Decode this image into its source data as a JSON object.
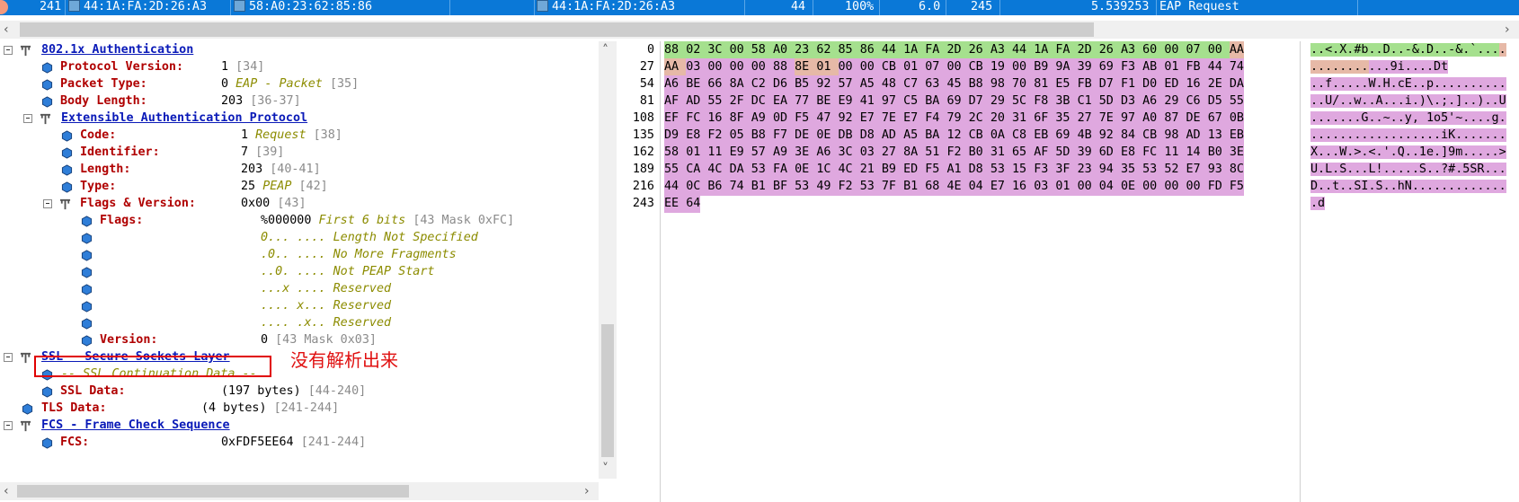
{
  "packet_row": {
    "no": "241",
    "src_mac": "44:1A:FA:2D:26:A3",
    "dst_mac": "58:A0:23:62:85:86",
    "transmitter": "44:1A:FA:2D:26:A3",
    "channel": "44",
    "signal": "100%",
    "rate": "6.0",
    "size": "245",
    "time": "5.539253",
    "info": "EAP Request"
  },
  "tree": {
    "dot1x": {
      "label": "802.1x Authentication"
    },
    "protocol_version": {
      "label": "Protocol Version:",
      "value": "1",
      "range": "[34]"
    },
    "packet_type": {
      "label": "Packet Type:",
      "value": "0",
      "enum": "EAP - Packet",
      "range": "[35]"
    },
    "body_length": {
      "label": "Body Length:",
      "value": "203",
      "range": "[36-37]"
    },
    "eap": {
      "label": "Extensible Authentication Protocol"
    },
    "code": {
      "label": "Code:",
      "value": "1",
      "enum": "Request",
      "range": "[38]"
    },
    "identifier": {
      "label": "Identifier:",
      "value": "7",
      "range": "[39]"
    },
    "length": {
      "label": "Length:",
      "value": "203",
      "range": "[40-41]"
    },
    "type": {
      "label": "Type:",
      "value": "25",
      "enum": "PEAP",
      "range": "[42]"
    },
    "flags_version": {
      "label": "Flags & Version:",
      "value": "0x00",
      "range": "[43]"
    },
    "flags": {
      "label": "Flags:",
      "value": "%000000",
      "enum": "First 6 bits",
      "range": "[43 Mask 0xFC]"
    },
    "bit_rows": [
      "0... .... Length Not Specified",
      ".0.. .... No More Fragments",
      "..0. .... Not PEAP Start",
      "...x .... Reserved",
      ".... x... Reserved",
      ".... .x.. Reserved"
    ],
    "version": {
      "label": "Version:",
      "value": "0",
      "range": "[43 Mask 0x03]"
    },
    "ssl": {
      "label": "SSL - Secure Sockets Layer"
    },
    "ssl_cont": {
      "label": "-- SSL Continuation Data --"
    },
    "ssl_data": {
      "label": "SSL Data:",
      "value": "(197 bytes)",
      "range": "[44-240]"
    },
    "tls_data": {
      "label": "TLS Data:",
      "value": "(4 bytes)",
      "range": "[241-244]"
    },
    "fcs": {
      "label": "FCS - Frame Check Sequence"
    },
    "fcs_field": {
      "label": "FCS:",
      "value": "0xFDF5EE64",
      "range": "[241-244]"
    }
  },
  "annotation": "没有解析出来",
  "hex_rows": [
    {
      "offset": "0",
      "bytes": [
        "88",
        "02",
        "3C",
        "00",
        "58",
        "A0",
        "23",
        "62",
        "85",
        "86",
        "44",
        "1A",
        "FA",
        "2D",
        "26",
        "A3",
        "44",
        "1A",
        "FA",
        "2D",
        "26",
        "A3",
        "60",
        "00",
        "07",
        "00",
        "AA"
      ],
      "ascii": "..<.X.#b..D..-&.D..-&.`...."
    },
    {
      "offset": "27",
      "bytes": [
        "AA",
        "03",
        "00",
        "00",
        "00",
        "88",
        "8E",
        "01",
        "00",
        "00",
        "CB",
        "01",
        "07",
        "00",
        "CB",
        "19",
        "00",
        "B9",
        "9A",
        "39",
        "69",
        "F3",
        "AB",
        "01",
        "FB",
        "44",
        "74"
      ],
      "ascii": "...........9i....Dt"
    },
    {
      "offset": "54",
      "bytes": [
        "A6",
        "BE",
        "66",
        "8A",
        "C2",
        "D6",
        "B5",
        "92",
        "57",
        "A5",
        "48",
        "C7",
        "63",
        "45",
        "B8",
        "98",
        "70",
        "81",
        "E5",
        "FB",
        "D7",
        "F1",
        "D0",
        "ED",
        "16",
        "2E",
        "DA"
      ],
      "ascii": "..f.....W.H.cE..p.........."
    },
    {
      "offset": "81",
      "bytes": [
        "AF",
        "AD",
        "55",
        "2F",
        "DC",
        "EA",
        "77",
        "BE",
        "E9",
        "41",
        "97",
        "C5",
        "BA",
        "69",
        "D7",
        "29",
        "5C",
        "F8",
        "3B",
        "C1",
        "5D",
        "D3",
        "A6",
        "29",
        "C6",
        "D5",
        "55"
      ],
      "ascii": "..U/..w..A...i.)\\.;.]..)..U"
    },
    {
      "offset": "108",
      "bytes": [
        "EF",
        "FC",
        "16",
        "8F",
        "A9",
        "0D",
        "F5",
        "47",
        "92",
        "E7",
        "7E",
        "E7",
        "F4",
        "79",
        "2C",
        "20",
        "31",
        "6F",
        "35",
        "27",
        "7E",
        "97",
        "A0",
        "87",
        "DE",
        "67",
        "0B"
      ],
      "ascii": ".......G..~..y, 1o5'~....g."
    },
    {
      "offset": "135",
      "bytes": [
        "D9",
        "E8",
        "F2",
        "05",
        "B8",
        "F7",
        "DE",
        "0E",
        "DB",
        "D8",
        "AD",
        "A5",
        "BA",
        "12",
        "CB",
        "0A",
        "C8",
        "EB",
        "69",
        "4B",
        "92",
        "84",
        "CB",
        "98",
        "AD",
        "13",
        "EB"
      ],
      "ascii": "..................iK......."
    },
    {
      "offset": "162",
      "bytes": [
        "58",
        "01",
        "11",
        "E9",
        "57",
        "A9",
        "3E",
        "A6",
        "3C",
        "03",
        "27",
        "8A",
        "51",
        "F2",
        "B0",
        "31",
        "65",
        "AF",
        "5D",
        "39",
        "6D",
        "E8",
        "FC",
        "11",
        "14",
        "B0",
        "3E"
      ],
      "ascii": "X...W.>.<.'.Q..1e.]9m.....>"
    },
    {
      "offset": "189",
      "bytes": [
        "55",
        "CA",
        "4C",
        "DA",
        "53",
        "FA",
        "0E",
        "1C",
        "4C",
        "21",
        "B9",
        "ED",
        "F5",
        "A1",
        "D8",
        "53",
        "15",
        "F3",
        "3F",
        "23",
        "94",
        "35",
        "53",
        "52",
        "E7",
        "93",
        "8C"
      ],
      "ascii": "U.L.S...L!.....S..?#.5SR..."
    },
    {
      "offset": "216",
      "bytes": [
        "44",
        "0C",
        "B6",
        "74",
        "B1",
        "BF",
        "53",
        "49",
        "F2",
        "53",
        "7F",
        "B1",
        "68",
        "4E",
        "04",
        "E7",
        "16",
        "03",
        "01",
        "00",
        "04",
        "0E",
        "00",
        "00",
        "00",
        "FD",
        "F5"
      ],
      "ascii": "D..t..SI.S..hN............."
    },
    {
      "offset": "243",
      "bytes": [
        "EE",
        "64"
      ],
      "ascii": ".d"
    }
  ],
  "colors": {
    "row_blue": "#0a78d7",
    "proto_blue": "#0a1ab8",
    "field_red": "#b00000",
    "enum_olive": "#8c8c00",
    "hex_green": "#a5e08e",
    "hex_purple": "#dfa8df",
    "annotation_red": "#e00000"
  }
}
